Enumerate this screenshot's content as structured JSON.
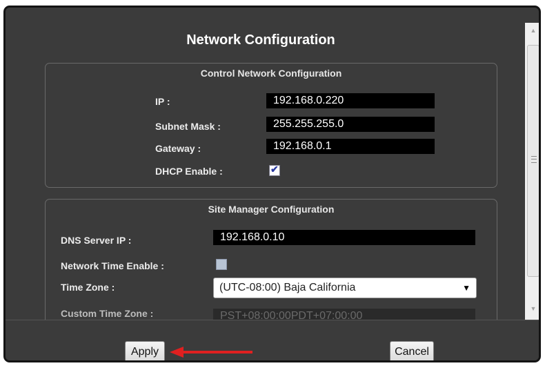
{
  "dialog": {
    "title": "Network Configuration"
  },
  "control_network": {
    "title": "Control Network Configuration",
    "ip_label": "IP :",
    "ip_value": "192.168.0.220",
    "subnet_label": "Subnet Mask :",
    "subnet_value": "255.255.255.0",
    "gateway_label": "Gateway :",
    "gateway_value": "192.168.0.1",
    "dhcp_label": "DHCP Enable :",
    "dhcp_checked": true
  },
  "site_manager": {
    "title": "Site Manager Configuration",
    "dns_label": "DNS Server IP :",
    "dns_value": "192.168.0.10",
    "ntp_label": "Network Time Enable :",
    "ntp_checked": false,
    "tz_label": "Time Zone :",
    "tz_value": "(UTC-08:00) Baja California",
    "custom_tz_label": "Custom Time Zone :",
    "custom_tz_value": "PST+08:00:00PDT+07:00:00"
  },
  "footer": {
    "apply_label": "Apply",
    "cancel_label": "Cancel"
  },
  "colors": {
    "dialog_bg": "#3b3b3b",
    "annotation_arrow": "#e02020"
  },
  "icons": {
    "checkbox": "checkmark-icon",
    "dropdown": "caret-down-icon",
    "scroll_up": "scroll-up-icon",
    "scroll_down": "scroll-down-icon"
  }
}
